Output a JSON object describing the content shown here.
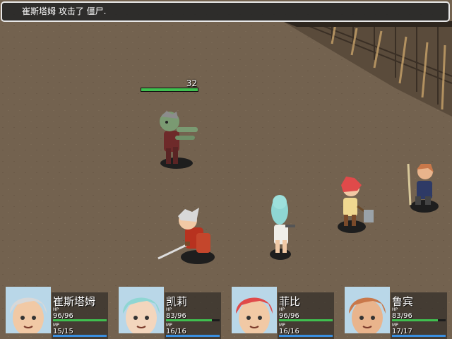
{
  "message": "崔斯塔姆 攻击了 僵尸.",
  "enemy": {
    "name_icon": "zombie-sprite",
    "hp_value": "32",
    "hp_ratio": 1
  },
  "party": [
    {
      "name": "崔斯塔姆",
      "hp_label": "HP",
      "hp": "96/96",
      "hp_ratio": 1,
      "mp_label": "MP",
      "mp": "15/15",
      "mp_ratio": 1,
      "hair": "#d8d8d8",
      "skin": "#f1c9a5"
    },
    {
      "name": "凯莉",
      "hp_label": "HP",
      "hp": "83/96",
      "hp_ratio": 0.86,
      "mp_label": "MP",
      "mp": "16/16",
      "mp_ratio": 1,
      "hair": "#8fd6d3",
      "skin": "#f3d6bd"
    },
    {
      "name": "菲比",
      "hp_label": "HP",
      "hp": "96/96",
      "hp_ratio": 1,
      "mp_label": "MP",
      "mp": "16/16",
      "mp_ratio": 1,
      "hair": "#e04a4a",
      "skin": "#f1c9a5"
    },
    {
      "name": "鲁宾",
      "hp_label": "HP",
      "hp": "83/96",
      "hp_ratio": 0.86,
      "mp_label": "MP",
      "mp": "17/17",
      "mp_ratio": 1,
      "hair": "#c9784a",
      "skin": "#e9b48c"
    }
  ]
}
